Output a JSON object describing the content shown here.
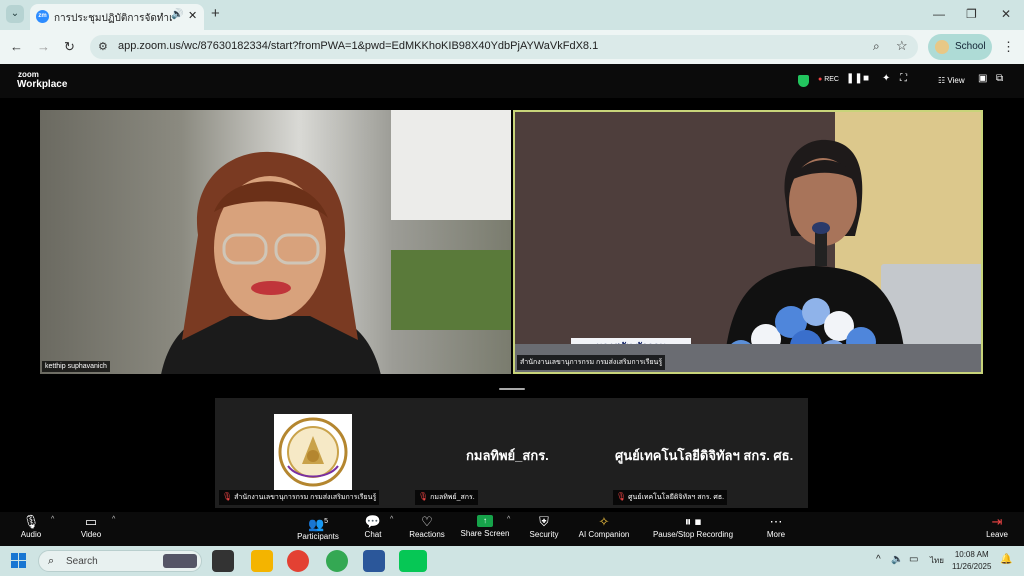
{
  "browser": {
    "tab_title": "การประชุมปฏิบัติการจัดทำแผนพัฒนา",
    "tab_favicon": "zm",
    "url": "app.zoom.us/wc/87630182334/start?fromPWA=1&pwd=EdMKKhoKIB98X40YdbPjAYWaVkFdX8.1",
    "profile_label": "School"
  },
  "zoom": {
    "brand_top": "zoom",
    "brand_bottom": "Workplace",
    "rec_label": "REC",
    "view_label": "View",
    "participants_count": "5"
  },
  "videos": [
    {
      "name": "ketthip suphavanich"
    },
    {
      "name": "สำนักงานเลขานุการกรม กรมส่งเสริมการเรียนรู้",
      "nameplate": "นางสุภัท มัวจอม"
    }
  ],
  "strip": [
    {
      "label": "สำนักงานเลขานุการกรม กรมส่งเสริมการเรียนรู้"
    },
    {
      "display": "กมลทิพย์_สกร.",
      "label": "กมลทิพย์_สกร."
    },
    {
      "display": "ศูนย์เทคโนโลยีดิจิทัลฯ สกร. ศธ.",
      "label": "ศูนย์เทคโนโลยีดิจิทัลฯ สกร. ศธ."
    }
  ],
  "toolbar": {
    "audio": "Audio",
    "video": "Video",
    "participants": "Participants",
    "chat": "Chat",
    "reactions": "Reactions",
    "share": "Share Screen",
    "security": "Security",
    "ai": "AI Companion",
    "pause": "Pause/Stop Recording",
    "more": "More",
    "leave": "Leave"
  },
  "taskbar": {
    "search_placeholder": "Search",
    "lang": "ไทย",
    "time": "10:08 AM",
    "date": "11/26/2025"
  }
}
